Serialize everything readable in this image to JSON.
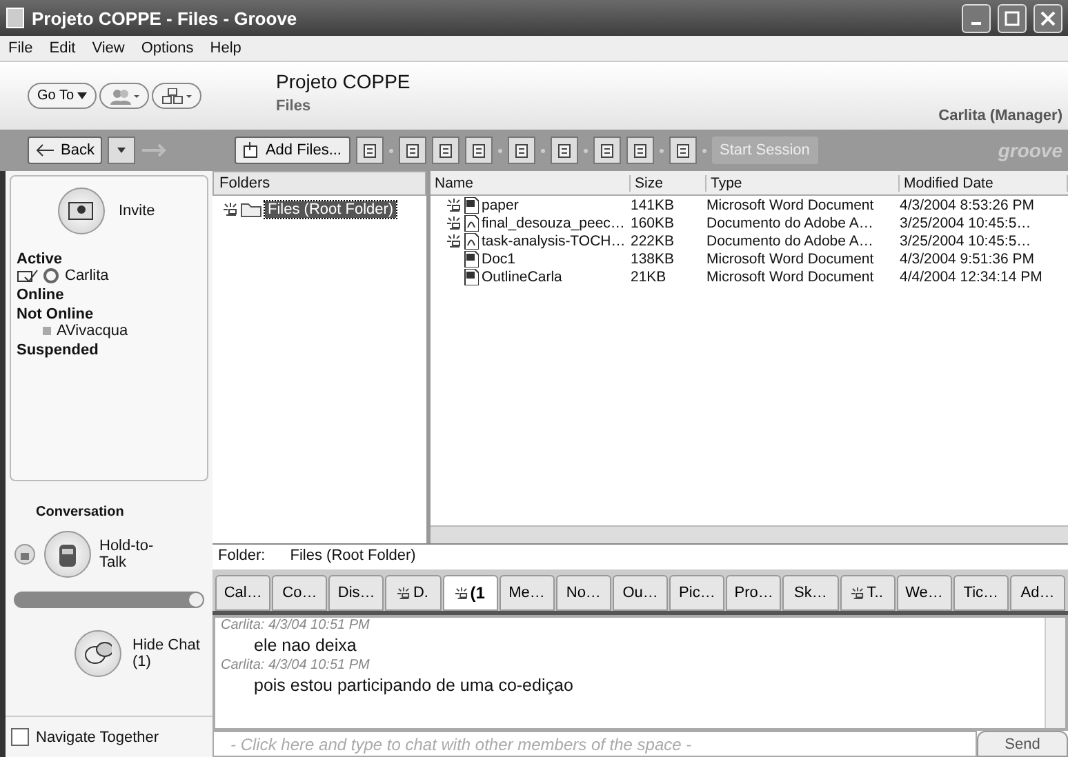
{
  "window": {
    "title": "Projeto COPPE - Files - Groove"
  },
  "menu": [
    "File",
    "Edit",
    "View",
    "Options",
    "Help"
  ],
  "header": {
    "goto": "Go To",
    "space": "Projeto COPPE",
    "tool": "Files",
    "user": "Carlita (Manager)"
  },
  "toolbar": {
    "back": "Back",
    "add_files": "Add Files...",
    "start_session": {
      "label": "Start Session",
      "disabled": true
    },
    "logo": "groove"
  },
  "sidebar": {
    "invite": "Invite",
    "groups": [
      {
        "label": "Active",
        "members": [
          {
            "name": "Carlita",
            "kind": "active"
          }
        ]
      },
      {
        "label": "Online"
      },
      {
        "label": "Not Online",
        "members": [
          {
            "name": "AVivacqua",
            "kind": "offline"
          }
        ]
      },
      {
        "label": "Suspended"
      }
    ],
    "conversation": "Conversation",
    "talk": "Hold-to-Talk",
    "volume": {
      "level": 1
    },
    "hide_chat": "Hide Chat (1)",
    "navigate": {
      "label": "Navigate Together",
      "checked": false
    }
  },
  "folders": {
    "heading": "Folders",
    "items": [
      {
        "label": "Files (Root Folder)",
        "selected": true,
        "unread": true
      }
    ]
  },
  "table": {
    "columns": [
      "Name",
      "Size",
      "Type",
      "Modified Date"
    ],
    "rows": [
      {
        "name": "paper",
        "size": "141KB",
        "type": "Microsoft Word Document",
        "date": "4/3/2004 8:53:26 PM",
        "kind": "word",
        "unread": true
      },
      {
        "name": "final_desouza_peec…",
        "size": "160KB",
        "type": "Documento do Adobe A…",
        "date": "3/25/2004 10:45:5…",
        "kind": "pdf",
        "unread": true
      },
      {
        "name": "task-analysis-TOCH…",
        "size": "222KB",
        "type": "Documento do Adobe A…",
        "date": "3/25/2004 10:45:5…",
        "kind": "pdf",
        "unread": true
      },
      {
        "name": "Doc1",
        "size": "138KB",
        "type": "Microsoft Word Document",
        "date": "4/3/2004 9:51:36 PM",
        "kind": "word",
        "unread": false
      },
      {
        "name": "OutlineCarla",
        "size": "21KB",
        "type": "Microsoft Word Document",
        "date": "4/4/2004 12:34:14 PM",
        "kind": "word",
        "unread": false
      }
    ]
  },
  "folder_bar": {
    "label": "Folder:",
    "value": "Files (Root Folder)"
  },
  "tabs": [
    {
      "label": "Cal…",
      "selected": false,
      "unread": false
    },
    {
      "label": "Co…",
      "selected": false,
      "unread": false
    },
    {
      "label": "Dis…",
      "selected": false,
      "unread": false
    },
    {
      "label": "D.",
      "selected": false,
      "unread": true
    },
    {
      "label": "(1",
      "selected": true,
      "unread": true
    },
    {
      "label": "Me…",
      "selected": false,
      "unread": false
    },
    {
      "label": "No…",
      "selected": false,
      "unread": false
    },
    {
      "label": "Ou…",
      "selected": false,
      "unread": false
    },
    {
      "label": "Pic…",
      "selected": false,
      "unread": false
    },
    {
      "label": "Pro…",
      "selected": false,
      "unread": false
    },
    {
      "label": "Sk…",
      "selected": false,
      "unread": false
    },
    {
      "label": "T..",
      "selected": false,
      "unread": true
    },
    {
      "label": "We…",
      "selected": false,
      "unread": false
    },
    {
      "label": "Tic…",
      "selected": false,
      "unread": false
    },
    {
      "label": "Ad…",
      "selected": false,
      "unread": false
    }
  ],
  "chat": {
    "messages": [
      {
        "author": "Carlita:",
        "time": "4/3/04 10:51 PM",
        "text": "ele nao deixa"
      },
      {
        "author": "Carlita:",
        "time": "4/3/04 10:51 PM",
        "text": "pois estou participando de uma co-ediçao"
      }
    ],
    "placeholder": "- Click here and type to chat with other members of the space -",
    "send": "Send"
  }
}
